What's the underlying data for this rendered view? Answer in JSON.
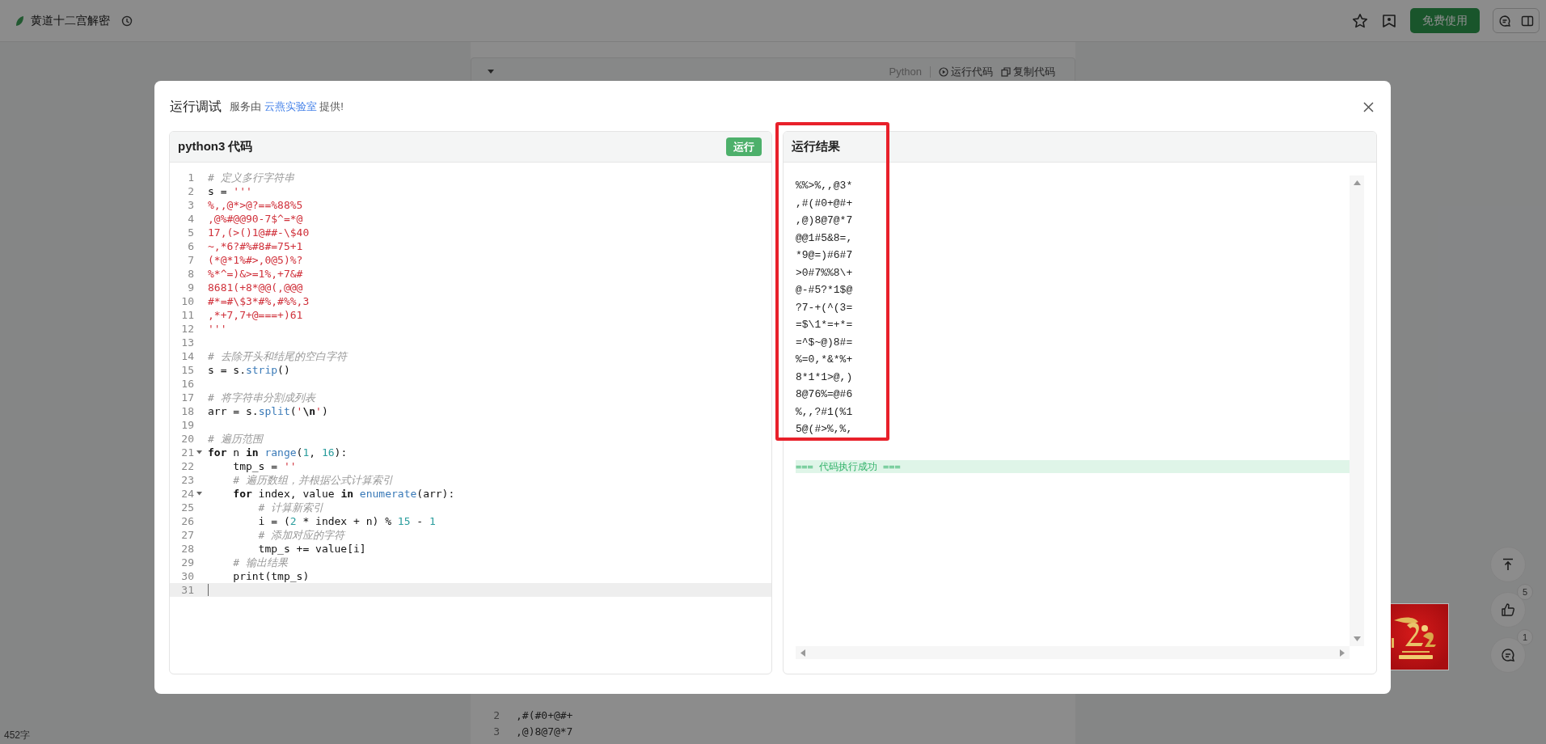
{
  "top_bar": {
    "title": "黄道十二宫解密",
    "primary_button": "免费使用"
  },
  "article": {
    "code_block": {
      "language": "Python",
      "actions": [
        {
          "kind": "run",
          "label": "运行代码"
        },
        {
          "kind": "copy",
          "label": "复制代码"
        }
      ],
      "lines": [
        {
          "number": "2",
          "text": ",#(#0+@#+"
        },
        {
          "number": "3",
          "text": ",@)8@7@*7"
        }
      ]
    },
    "word_count": "452字"
  },
  "float_actions": [
    {
      "kind": "top"
    },
    {
      "kind": "like",
      "count": "5"
    },
    {
      "kind": "comment",
      "count": "1"
    }
  ],
  "dialog": {
    "title": "运行调试",
    "credit": {
      "prefix": "服务由",
      "link": "云燕实验室",
      "suffix": "提供!"
    },
    "editor": {
      "title": "python3 代码",
      "run_button": "运行",
      "lines": [
        {
          "number": "1",
          "foldable": false,
          "active": false,
          "tokens": [
            {
              "kind": "comment",
              "text": "# 定义多行字符串"
            }
          ]
        },
        {
          "number": "2",
          "foldable": false,
          "active": false,
          "tokens": [
            {
              "kind": "plain",
              "text": "s = "
            },
            {
              "kind": "string",
              "text": "'''"
            }
          ]
        },
        {
          "number": "3",
          "foldable": false,
          "active": false,
          "tokens": [
            {
              "kind": "string",
              "text": "%,,@*>@?==%88%5"
            }
          ]
        },
        {
          "number": "4",
          "foldable": false,
          "active": false,
          "tokens": [
            {
              "kind": "string",
              "text": ",@%#@@90-7$^=*@"
            }
          ]
        },
        {
          "number": "5",
          "foldable": false,
          "active": false,
          "tokens": [
            {
              "kind": "string",
              "text": "17,(>()1@##-\\$40"
            }
          ]
        },
        {
          "number": "6",
          "foldable": false,
          "active": false,
          "tokens": [
            {
              "kind": "string",
              "text": "~,*6?#%#8#=75+1"
            }
          ]
        },
        {
          "number": "7",
          "foldable": false,
          "active": false,
          "tokens": [
            {
              "kind": "string",
              "text": "(*@*1%#>,0@5)%?"
            }
          ]
        },
        {
          "number": "8",
          "foldable": false,
          "active": false,
          "tokens": [
            {
              "kind": "string",
              "text": "%*^=)&>=1%,+7&#"
            }
          ]
        },
        {
          "number": "9",
          "foldable": false,
          "active": false,
          "tokens": [
            {
              "kind": "string",
              "text": "8681(+8*@@(,@@@"
            }
          ]
        },
        {
          "number": "10",
          "foldable": false,
          "active": false,
          "tokens": [
            {
              "kind": "string",
              "text": "#*=#\\$3*#%,#%%,3"
            }
          ]
        },
        {
          "number": "11",
          "foldable": false,
          "active": false,
          "tokens": [
            {
              "kind": "string",
              "text": ",*+7,7+@===+)61"
            }
          ]
        },
        {
          "number": "12",
          "foldable": false,
          "active": false,
          "tokens": [
            {
              "kind": "string",
              "text": "'''"
            }
          ]
        },
        {
          "number": "13",
          "foldable": false,
          "active": false
        },
        {
          "number": "14",
          "foldable": false,
          "active": false,
          "tokens": [
            {
              "kind": "comment",
              "text": "# 去除开头和结尾的空白字符"
            }
          ]
        },
        {
          "number": "15",
          "foldable": false,
          "active": false,
          "tokens": [
            {
              "kind": "plain",
              "text": "s = s."
            },
            {
              "kind": "builtin",
              "text": "strip"
            },
            {
              "kind": "plain",
              "text": "()"
            }
          ]
        },
        {
          "number": "16",
          "foldable": false,
          "active": false
        },
        {
          "number": "17",
          "foldable": false,
          "active": false,
          "tokens": [
            {
              "kind": "comment",
              "text": "# 将字符串分割成列表"
            }
          ]
        },
        {
          "number": "18",
          "foldable": false,
          "active": false,
          "tokens": [
            {
              "kind": "plain",
              "text": "arr = s."
            },
            {
              "kind": "builtin",
              "text": "split"
            },
            {
              "kind": "plain",
              "text": "("
            },
            {
              "kind": "string",
              "text": "'"
            },
            {
              "kind": "keyword",
              "text": "\\n"
            },
            {
              "kind": "string",
              "text": "'"
            },
            {
              "kind": "plain",
              "text": ")"
            }
          ]
        },
        {
          "number": "19",
          "foldable": false,
          "active": false
        },
        {
          "number": "20",
          "foldable": false,
          "active": false,
          "tokens": [
            {
              "kind": "comment",
              "text": "# 遍历范围"
            }
          ]
        },
        {
          "number": "21",
          "foldable": true,
          "active": false,
          "tokens": [
            {
              "kind": "keyword",
              "text": "for"
            },
            {
              "kind": "plain",
              "text": " n "
            },
            {
              "kind": "keyword",
              "text": "in"
            },
            {
              "kind": "builtin",
              "text": " range"
            },
            {
              "kind": "plain",
              "text": "("
            },
            {
              "kind": "number",
              "text": "1"
            },
            {
              "kind": "plain",
              "text": ", "
            },
            {
              "kind": "number",
              "text": "16"
            },
            {
              "kind": "plain",
              "text": "):"
            }
          ]
        },
        {
          "number": "22",
          "foldable": false,
          "active": false,
          "tokens": [
            {
              "kind": "plain",
              "text": "    tmp_s = "
            },
            {
              "kind": "string",
              "text": "''"
            }
          ]
        },
        {
          "number": "23",
          "foldable": false,
          "active": false,
          "tokens": [
            {
              "kind": "comment",
              "text": "    # 遍历数组，并根据公式计算索引"
            }
          ]
        },
        {
          "number": "24",
          "foldable": true,
          "active": false,
          "tokens": [
            {
              "kind": "keyword",
              "text": "    for"
            },
            {
              "kind": "plain",
              "text": " index, value "
            },
            {
              "kind": "keyword",
              "text": "in"
            },
            {
              "kind": "builtin",
              "text": " enumerate"
            },
            {
              "kind": "plain",
              "text": "(arr):"
            }
          ]
        },
        {
          "number": "25",
          "foldable": false,
          "active": false,
          "tokens": [
            {
              "kind": "comment",
              "text": "        # 计算新索引"
            }
          ]
        },
        {
          "number": "26",
          "foldable": false,
          "active": false,
          "tokens": [
            {
              "kind": "plain",
              "text": "        i = ("
            },
            {
              "kind": "number",
              "text": "2"
            },
            {
              "kind": "plain",
              "text": " * index + n) % "
            },
            {
              "kind": "number",
              "text": "15"
            },
            {
              "kind": "plain",
              "text": " - "
            },
            {
              "kind": "number",
              "text": "1"
            }
          ]
        },
        {
          "number": "27",
          "foldable": false,
          "active": false,
          "tokens": [
            {
              "kind": "comment",
              "text": "        # 添加对应的字符"
            }
          ]
        },
        {
          "number": "28",
          "foldable": false,
          "active": false,
          "tokens": [
            {
              "kind": "plain",
              "text": "        tmp_s += value[i]"
            }
          ]
        },
        {
          "number": "29",
          "foldable": false,
          "active": false,
          "tokens": [
            {
              "kind": "comment",
              "text": "    # 输出结果"
            }
          ]
        },
        {
          "number": "30",
          "foldable": false,
          "active": false,
          "tokens": [
            {
              "kind": "plain",
              "text": "    print(tmp_s)"
            }
          ]
        },
        {
          "number": "31",
          "foldable": false,
          "active": true
        }
      ]
    },
    "result": {
      "title": "运行结果",
      "highlighted": true,
      "output": [
        "%%>%,,@3*",
        ",#(#0+@#+",
        ",@)8@7@*7",
        "@@1#5&8=,",
        "*9@=)#6#7",
        ">0#7%%8\\+",
        "@-#5?*1$@",
        "?7-+(^(3=",
        "=$\\1*=+*=",
        "=^$~@)8#=",
        "%=0,*&*%+",
        "8*1*1>@,)",
        "8@76%=@#6",
        "%,,?#1(%1",
        "5@(#>%,%,"
      ],
      "status": "=== 代码执行成功 ==="
    }
  }
}
